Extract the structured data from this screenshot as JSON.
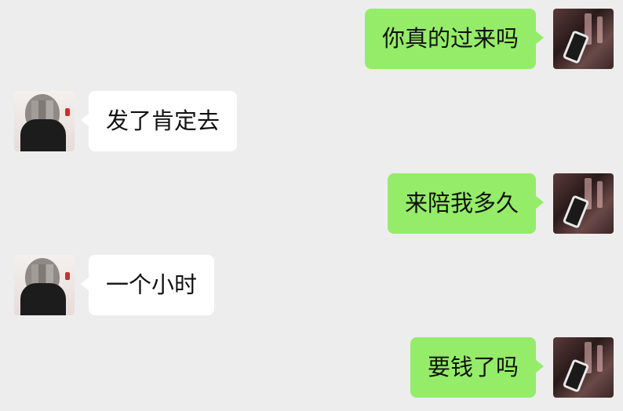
{
  "colors": {
    "background": "#ededed",
    "self_bubble": "#95ec69",
    "other_bubble": "#ffffff"
  },
  "messages": [
    {
      "sender": "self",
      "text": "你真的过来吗"
    },
    {
      "sender": "other",
      "text": "发了肯定去"
    },
    {
      "sender": "self",
      "text": "来陪我多久"
    },
    {
      "sender": "other",
      "text": "一个小时"
    },
    {
      "sender": "self",
      "text": "要钱了吗"
    }
  ]
}
